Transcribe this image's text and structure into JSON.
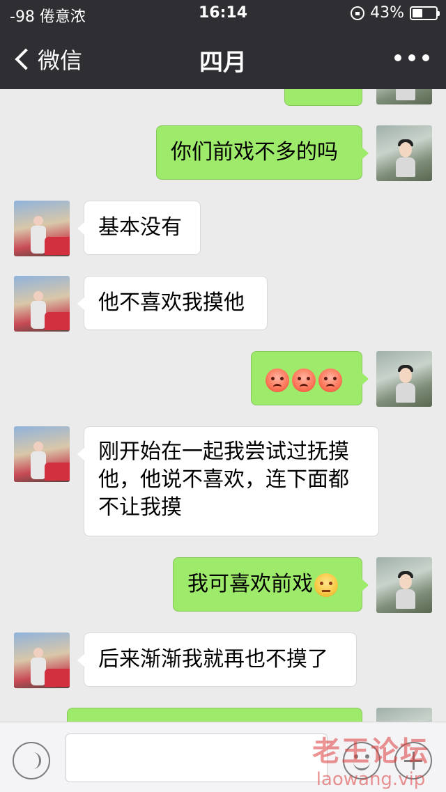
{
  "status_bar": {
    "carrier": "-98 倦意浓",
    "time": "16:14",
    "battery_percent": "43%",
    "battery_level": 0.43
  },
  "nav": {
    "back_label": "微信",
    "title": "四月",
    "more_icon": "more-dots-icon"
  },
  "colors": {
    "nav_bg": "#2e2e33",
    "chat_bg": "#ebebeb",
    "my_bubble": "#9eea6a",
    "their_bubble": "#ffffff"
  },
  "messages": [
    {
      "sender": "me",
      "text": ""
    },
    {
      "sender": "me",
      "text": "你们前戏不多的吗"
    },
    {
      "sender": "her",
      "text": "基本没有"
    },
    {
      "sender": "her",
      "text": "他不喜欢我摸他"
    },
    {
      "sender": "me",
      "text": "",
      "emoji": [
        "angry-face-icon",
        "angry-face-icon",
        "angry-face-icon"
      ]
    },
    {
      "sender": "her",
      "lines": [
        "刚开始在一起我尝试过抚摸",
        "他，他说不喜欢，连下面都",
        "不让我摸"
      ]
    },
    {
      "sender": "me",
      "text": "我可喜欢前戏",
      "emoji": [
        "smirk-face-icon"
      ]
    },
    {
      "sender": "her",
      "text": "后来渐渐我就再也不摸了"
    },
    {
      "sender": "me",
      "text": ""
    }
  ],
  "input_bar": {
    "voice_icon": "voice-icon",
    "emoji_icon": "emoji-smile-icon",
    "plus_icon": "plus-icon",
    "value": ""
  },
  "watermark": {
    "title": "老王论坛",
    "url": "laowang.vip"
  }
}
